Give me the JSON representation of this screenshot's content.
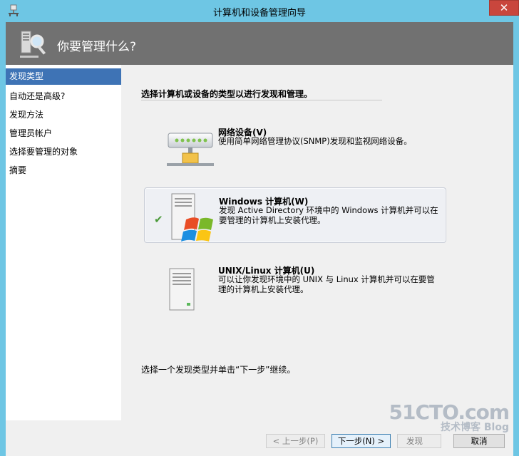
{
  "window": {
    "title": "计算机和设备管理向导",
    "close_glyph": "✕"
  },
  "header": {
    "title": "你要管理什么?"
  },
  "sidebar": {
    "items": [
      {
        "label": "发现类型",
        "active": true
      },
      {
        "label": "自动还是高级?",
        "active": false
      },
      {
        "label": "发现方法",
        "active": false
      },
      {
        "label": "管理员帐户",
        "active": false
      },
      {
        "label": "选择要管理的对象",
        "active": false
      },
      {
        "label": "摘要",
        "active": false
      }
    ]
  },
  "main": {
    "section_title": "选择计算机或设备的类型以进行发现和管理。",
    "options": [
      {
        "title": "网络设备(V)",
        "description": "使用简单网络管理协议(SNMP)发现和监视网络设备。",
        "selected": false
      },
      {
        "title": "Windows 计算机(W)",
        "description": "发现 Active Directory 环境中的 Windows 计算机并可以在要管理的计算机上安装代理。",
        "selected": true
      },
      {
        "title": "UNIX/Linux 计算机(U)",
        "description": "可以让你发现环境中的 UNIX 与 Linux 计算机并可以在要管理的计算机上安装代理。",
        "selected": false
      }
    ],
    "hint": "选择一个发现类型并单击“下一步”继续。"
  },
  "footer": {
    "prev_label": "< 上一步(P)",
    "next_label": "下一步(N) >",
    "discover_label": "发现",
    "cancel_label": "取消"
  },
  "watermark": {
    "line1": "51CTO.com",
    "line2": "技术博客 Blog"
  },
  "colors": {
    "titlebar": "#6ec6e4",
    "header": "#717171",
    "nav_active": "#3e73b5",
    "close": "#c9463d"
  }
}
